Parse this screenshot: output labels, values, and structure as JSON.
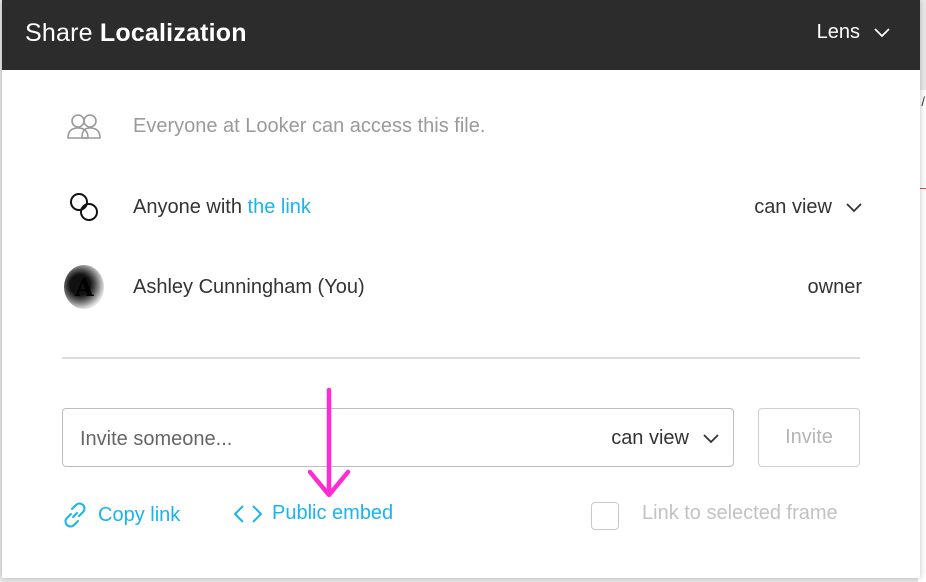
{
  "header": {
    "title_prefix": "Share",
    "title_name": "Localization",
    "lens_label": "Lens"
  },
  "access": {
    "org_text": "Everyone at Looker can access this file.",
    "link_prefix": "Anyone with ",
    "link_text": "the link",
    "link_permission": "can view",
    "user_name": "Ashley Cunningham (You)",
    "user_role": "owner"
  },
  "invite": {
    "placeholder": "Invite someone...",
    "permission": "can view",
    "button_label": "Invite"
  },
  "footer": {
    "copy_link": "Copy link",
    "public_embed": "Public embed",
    "selected_frame_label": "Link to selected frame"
  },
  "colors": {
    "accent": "#18b4f0",
    "header_bg": "#2c2c2c",
    "annotation_arrow": "#ff2bd0"
  },
  "icons": [
    "users-icon",
    "link-icon",
    "chevron-down-icon",
    "copy-link-icon",
    "code-icon",
    "arrow-down-annotation"
  ]
}
